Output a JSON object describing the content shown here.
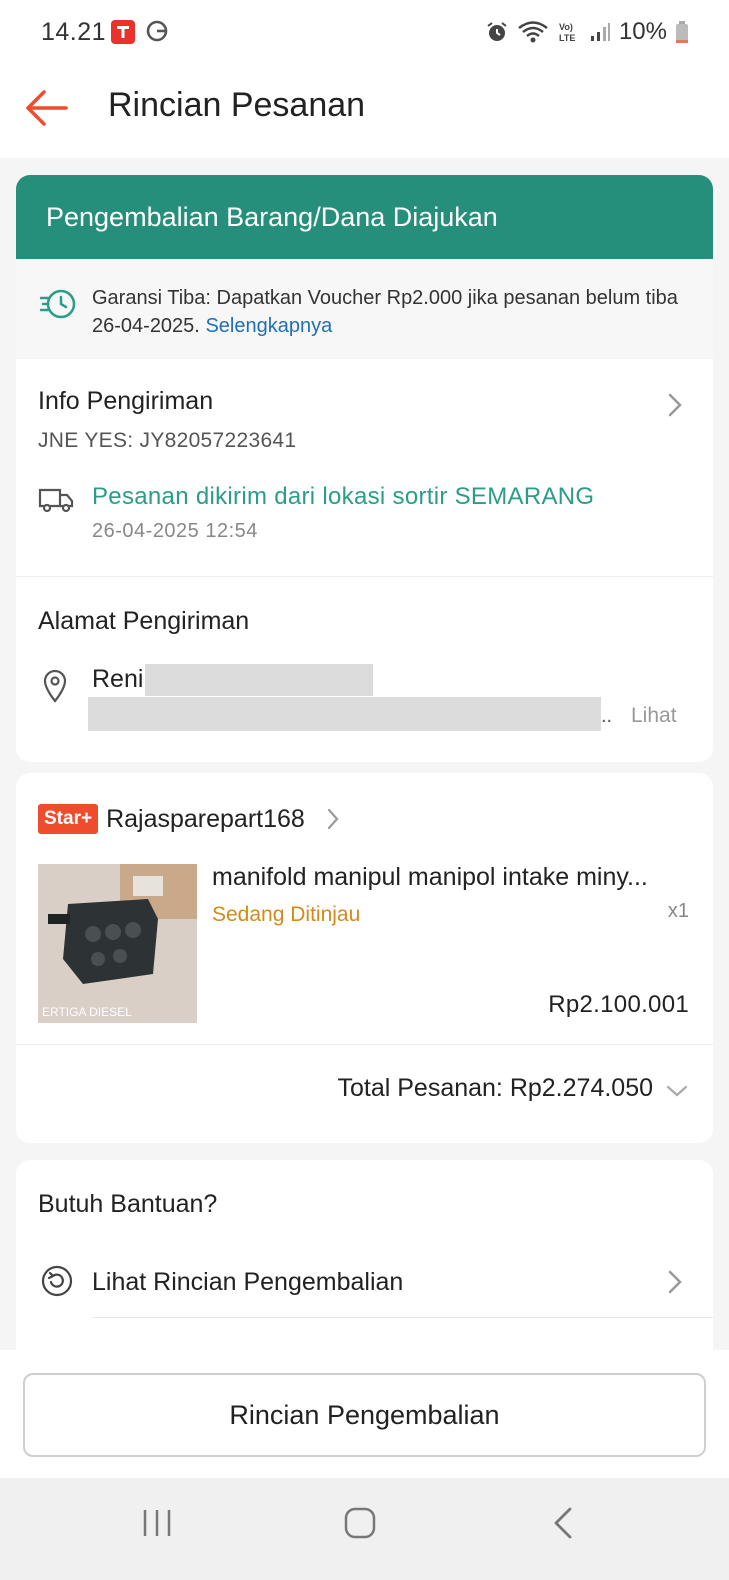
{
  "status_bar": {
    "time": "14.21",
    "battery": "10%"
  },
  "header": {
    "title": "Rincian Pesanan"
  },
  "order_status": {
    "title": "Pengembalian Barang/Dana Diajukan"
  },
  "guarantee": {
    "text": "Garansi Tiba: Dapatkan Voucher Rp2.000 jika pesanan belum tiba 26-04-2025.",
    "link": "Selengkapnya"
  },
  "shipping": {
    "title": "Info Pengiriman",
    "tracking": "JNE YES: JY82057223641",
    "status": "Pesanan dikirim dari lokasi sortir  SEMARANG",
    "datetime": "26-04-2025 12:54"
  },
  "address": {
    "title": "Alamat Pengiriman",
    "name": "Reni",
    "ellipsis": "..",
    "view_label": "Lihat"
  },
  "shop": {
    "badge": "Star+",
    "name": "Rajasparepart168"
  },
  "product": {
    "title": "manifold manipul manipol intake miny...",
    "status": "Sedang Ditinjau",
    "qty": "x1",
    "price": "Rp2.100.001",
    "image_caption": "ERTIGA DIESEL"
  },
  "total": {
    "label": "Total Pesanan: Rp2.274.050"
  },
  "help": {
    "title": "Butuh Bantuan?",
    "items": [
      {
        "label": "Lihat Rincian Pengembalian",
        "icon": "return-icon"
      }
    ]
  },
  "bottom_action": {
    "button_label": "Rincian Pengembalian"
  },
  "colors": {
    "status_header": "#268f7b",
    "accent": "#ee4d2d",
    "link": "#1f6fb5",
    "shipping_status": "#2a9d88",
    "product_status": "#d48a1a"
  }
}
